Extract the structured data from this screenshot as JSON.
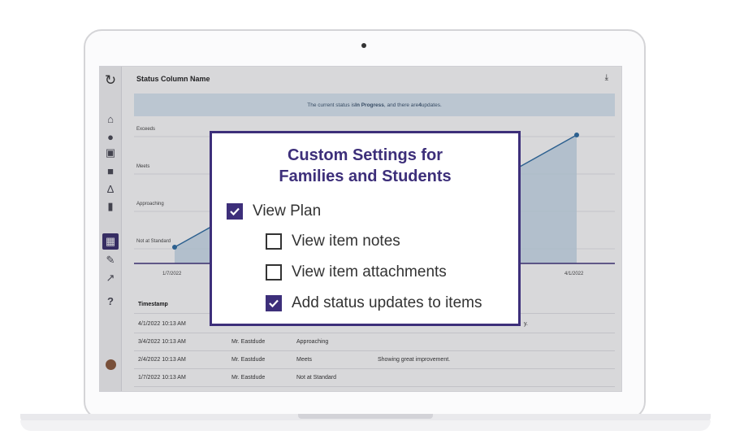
{
  "header": {
    "title": "Status Column Name"
  },
  "banner": {
    "prefix": "The current status is ",
    "status": "In Progress",
    "middle": ", and there are ",
    "count": "4",
    "suffix": " updates."
  },
  "chart_data": {
    "type": "area",
    "y_levels": [
      "Not at Standard",
      "Approaching",
      "Meets",
      "Exceeds"
    ],
    "x": [
      "1/7/2022",
      "2/4/2022",
      "3/4/2022",
      "4/1/2022"
    ],
    "values": [
      "Not at Standard",
      "Meets",
      "Approaching",
      "Exceeds"
    ],
    "visible_tick_labels": [
      "1/7/2022",
      "4/1/2022"
    ],
    "color": "#2e6da4"
  },
  "table": {
    "columns": [
      "Timestamp",
      "",
      "",
      ""
    ],
    "rows": [
      [
        "4/1/2022 10:13 AM",
        "",
        "",
        "y."
      ],
      [
        "3/4/2022 10:13 AM",
        "Mr. Eastdude",
        "Approaching",
        ""
      ],
      [
        "2/4/2022 10:13 AM",
        "Mr. Eastdude",
        "Meets",
        "Showing great improvement."
      ],
      [
        "1/7/2022 10:13 AM",
        "Mr. Eastdude",
        "Not at Standard",
        ""
      ]
    ]
  },
  "modal": {
    "title_line1": "Custom Settings for",
    "title_line2": "Families and Students",
    "options": [
      {
        "label": "View Plan",
        "checked": true
      },
      {
        "label": "View item notes",
        "checked": false
      },
      {
        "label": "View item attachments",
        "checked": false
      },
      {
        "label": "Add status updates to items",
        "checked": true
      }
    ]
  },
  "sidebar": {
    "icons": [
      "logo-icon",
      "home-icon",
      "users-icon",
      "presentation-icon",
      "book-icon",
      "compass-icon",
      "bookmark-icon",
      "map-icon",
      "edit-icon",
      "chart-icon",
      "help-icon",
      "avatar"
    ]
  },
  "colors": {
    "accent": "#3d2f7a",
    "line": "#2e6da4",
    "banner_bg": "#dceaf4"
  }
}
